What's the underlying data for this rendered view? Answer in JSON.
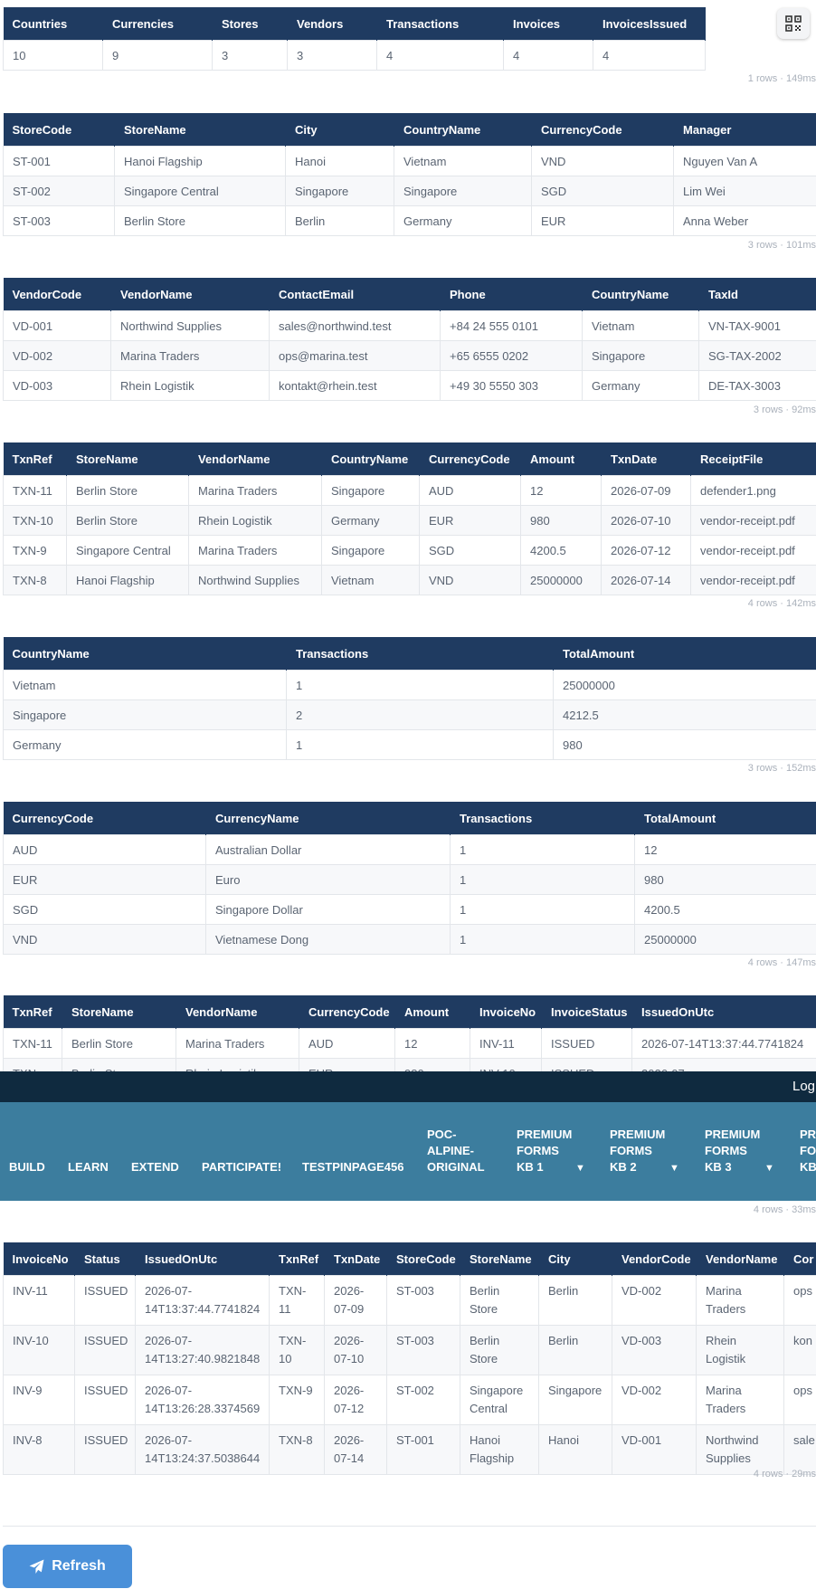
{
  "summary": {
    "headers": [
      "Countries",
      "Currencies",
      "Stores",
      "Vendors",
      "Transactions",
      "Invoices",
      "InvoicesIssued"
    ],
    "row": [
      "10",
      "9",
      "3",
      "3",
      "4",
      "4",
      "4"
    ],
    "meta": "1 rows · 149ms"
  },
  "stores": {
    "headers": [
      "StoreCode",
      "StoreName",
      "City",
      "CountryName",
      "CurrencyCode",
      "Manager"
    ],
    "rows": [
      [
        "ST-001",
        "Hanoi Flagship",
        "Hanoi",
        "Vietnam",
        "VND",
        "Nguyen Van A"
      ],
      [
        "ST-002",
        "Singapore Central",
        "Singapore",
        "Singapore",
        "SGD",
        "Lim Wei"
      ],
      [
        "ST-003",
        "Berlin Store",
        "Berlin",
        "Germany",
        "EUR",
        "Anna Weber"
      ]
    ],
    "meta": "3 rows · 101ms"
  },
  "vendors": {
    "headers": [
      "VendorCode",
      "VendorName",
      "ContactEmail",
      "Phone",
      "CountryName",
      "TaxId"
    ],
    "rows": [
      [
        "VD-001",
        "Northwind Supplies",
        "sales@northwind.test",
        "+84 24 555 0101",
        "Vietnam",
        "VN-TAX-9001"
      ],
      [
        "VD-002",
        "Marina Traders",
        "ops@marina.test",
        "+65 6555 0202",
        "Singapore",
        "SG-TAX-2002"
      ],
      [
        "VD-003",
        "Rhein Logistik",
        "kontakt@rhein.test",
        "+49 30 5550 303",
        "Germany",
        "DE-TAX-3003"
      ]
    ],
    "meta": "3 rows · 92ms"
  },
  "transactions": {
    "headers": [
      "TxnRef",
      "StoreName",
      "VendorName",
      "CountryName",
      "CurrencyCode",
      "Amount",
      "TxnDate",
      "ReceiptFile"
    ],
    "rows": [
      [
        "TXN-11",
        "Berlin Store",
        "Marina Traders",
        "Singapore",
        "AUD",
        "12",
        "2026-07-09",
        "defender1.png"
      ],
      [
        "TXN-10",
        "Berlin Store",
        "Rhein Logistik",
        "Germany",
        "EUR",
        "980",
        "2026-07-10",
        "vendor-receipt.pdf"
      ],
      [
        "TXN-9",
        "Singapore Central",
        "Marina Traders",
        "Singapore",
        "SGD",
        "4200.5",
        "2026-07-12",
        "vendor-receipt.pdf"
      ],
      [
        "TXN-8",
        "Hanoi Flagship",
        "Northwind Supplies",
        "Vietnam",
        "VND",
        "25000000",
        "2026-07-14",
        "vendor-receipt.pdf"
      ]
    ],
    "meta": "4 rows · 142ms"
  },
  "by_country": {
    "headers": [
      "CountryName",
      "Transactions",
      "TotalAmount"
    ],
    "rows": [
      [
        "Vietnam",
        "1",
        "25000000"
      ],
      [
        "Singapore",
        "2",
        "4212.5"
      ],
      [
        "Germany",
        "1",
        "980"
      ]
    ],
    "meta": "3 rows · 152ms"
  },
  "by_currency": {
    "headers": [
      "CurrencyCode",
      "CurrencyName",
      "Transactions",
      "TotalAmount"
    ],
    "rows": [
      [
        "AUD",
        "Australian Dollar",
        "1",
        "12"
      ],
      [
        "EUR",
        "Euro",
        "1",
        "980"
      ],
      [
        "SGD",
        "Singapore Dollar",
        "1",
        "4200.5"
      ],
      [
        "VND",
        "Vietnamese Dong",
        "1",
        "25000000"
      ]
    ],
    "meta": "4 rows · 147ms"
  },
  "txn_invoices": {
    "headers": [
      "TxnRef",
      "StoreName",
      "VendorName",
      "CurrencyCode",
      "Amount",
      "InvoiceNo",
      "InvoiceStatus",
      "IssuedOnUtc"
    ],
    "rows": [
      [
        "TXN-11",
        "Berlin Store",
        "Marina Traders",
        "AUD",
        "12",
        "INV-11",
        "ISSUED",
        "2026-07-14T13:37:44.7741824"
      ],
      [
        "TXN-",
        "Berlin Store",
        "Rhein Logistik",
        "EUR",
        "980",
        "INV-10",
        "ISSUED",
        "2026-07-"
      ]
    ],
    "meta": "4 rows · 33ms"
  },
  "nav": {
    "login": "Log",
    "items": [
      "BUILD",
      "LEARN",
      "EXTEND",
      "PARTICIPATE!",
      "TESTPINPAGE456",
      "POC-\nALPINE-\nORIGINAL",
      "PREMIUM\nFORMS\nKB 1",
      "PREMIUM\nFORMS\nKB 2",
      "PREMIUM\nFORMS\nKB 3",
      "PR\nFO\nKB"
    ],
    "caret": "▼"
  },
  "invoices": {
    "headers": [
      "InvoiceNo",
      "Status",
      "IssuedOnUtc",
      "TxnRef",
      "TxnDate",
      "StoreCode",
      "StoreName",
      "City",
      "VendorCode",
      "VendorName",
      "Cor"
    ],
    "rows": [
      [
        "INV-11",
        "ISSUED",
        "2026-07-14T13:37:44.7741824",
        "TXN-11",
        "2026-07-09",
        "ST-003",
        "Berlin Store",
        "Berlin",
        "VD-002",
        "Marina Traders",
        "ops"
      ],
      [
        "INV-10",
        "ISSUED",
        "2026-07-14T13:27:40.9821848",
        "TXN-10",
        "2026-07-10",
        "ST-003",
        "Berlin Store",
        "Berlin",
        "VD-003",
        "Rhein Logistik",
        "kon"
      ],
      [
        "INV-9",
        "ISSUED",
        "2026-07-14T13:26:28.3374569",
        "TXN-9",
        "2026-07-12",
        "ST-002",
        "Singapore Central",
        "Singapore",
        "VD-002",
        "Marina Traders",
        "ops"
      ],
      [
        "INV-8",
        "ISSUED",
        "2026-07-14T13:24:37.5038644",
        "TXN-8",
        "2026-07-14",
        "ST-001",
        "Hanoi Flagship",
        "Hanoi",
        "VD-001",
        "Northwind Supplies",
        "sale"
      ]
    ],
    "meta": "4 rows · 29ms"
  },
  "actions": {
    "refresh_label": "Refresh"
  },
  "colors": {
    "header_bg": "#1f3b61",
    "nav_bg": "#3c7d9e",
    "topbar_bg": "#0f2a3f",
    "button_bg": "#4a90d9"
  }
}
